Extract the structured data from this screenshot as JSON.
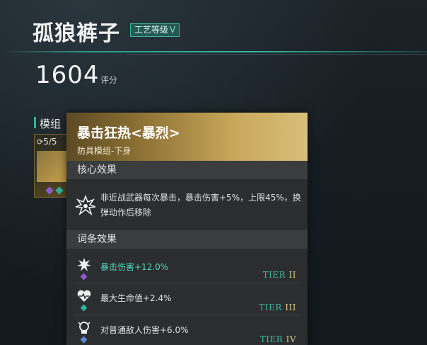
{
  "header": {
    "item_name": "孤狼裤子",
    "craft_label": "工艺等级",
    "craft_level": "V",
    "score_value": "1604",
    "score_label": "评分"
  },
  "module_panel": {
    "title": "模组",
    "count": "5/5"
  },
  "tooltip": {
    "name": "暴击狂热<暴烈>",
    "subtitle": "防具模组-下身",
    "core_section": "核心效果",
    "core_text": "非近战武器每次暴击，暴击伤害+5%，上限45%，换弹动作后移除",
    "traits_section": "词条效果",
    "traits": [
      {
        "text": "暴击伤害+12.0%",
        "tier_label": "TIER",
        "tier_roman": "II",
        "icon": "crit-burst-icon",
        "gem_color": "#8a5ccf",
        "highlight": true
      },
      {
        "text": "最大生命值+2.4%",
        "tier_label": "TIER",
        "tier_roman": "III",
        "icon": "heart-icon",
        "gem_color": "#2fb39c",
        "highlight": false
      },
      {
        "text": "对普通敌人伤害+6.0%",
        "tier_label": "TIER",
        "tier_roman": "IV",
        "icon": "enemy-damage-icon",
        "gem_color": "#5b87d6",
        "highlight": false
      }
    ]
  },
  "colors": {
    "accent": "#2fb39c",
    "gold": "#c9a85a"
  }
}
